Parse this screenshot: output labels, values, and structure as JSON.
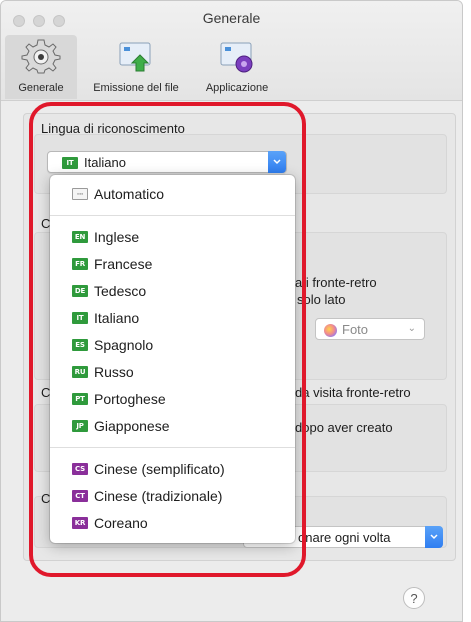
{
  "window": {
    "title": "Generale"
  },
  "toolbar": {
    "tabs": [
      {
        "label": "Generale",
        "icon": "gear-icon"
      },
      {
        "label": "Emissione del file",
        "icon": "file-output-icon"
      },
      {
        "label": "Applicazione",
        "icon": "application-icon"
      }
    ]
  },
  "recognition": {
    "label": "Lingua di riconoscimento",
    "selected": {
      "label": "Italiano",
      "code": "IT"
    }
  },
  "dropdown": {
    "automatic": "Automatico",
    "group1": [
      {
        "label": "Inglese",
        "code": "EN"
      },
      {
        "label": "Francese",
        "code": "FR"
      },
      {
        "label": "Tedesco",
        "code": "DE"
      },
      {
        "label": "Italiano",
        "code": "IT"
      },
      {
        "label": "Spagnolo",
        "code": "ES"
      },
      {
        "label": "Russo",
        "code": "RU"
      },
      {
        "label": "Portoghese",
        "code": "PT"
      },
      {
        "label": "Giapponese",
        "code": "JP"
      }
    ],
    "group2": [
      {
        "label": "Cinese (semplificato)",
        "code": "CS"
      },
      {
        "label": "Cinese (tradizionale)",
        "code": "CT"
      },
      {
        "label": "Coreano",
        "code": "KR"
      }
    ]
  },
  "behind": {
    "c1": "C",
    "c2": "C",
    "c3": "C",
    "duplex_line1": "ati fronte-retro",
    "duplex_line2": "solo lato",
    "photo_option": "Foto",
    "card_text": "da visita fronte-retro",
    "after_text": "dopo aver creato",
    "ask_option": "onare ogni volta",
    "help": "?"
  },
  "colors": {
    "annotation": "#e0182b",
    "accent": "#2f7ef1",
    "flag_green": "#2f9a3c",
    "flag_purple": "#8a2f9a"
  }
}
